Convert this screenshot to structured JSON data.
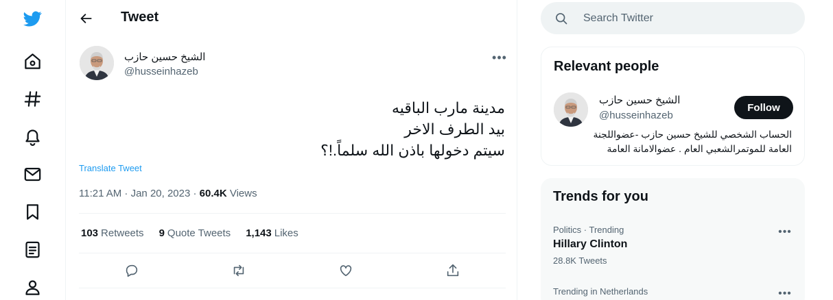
{
  "header": {
    "title": "Tweet"
  },
  "tweet": {
    "author_name": "الشيخ حسين حازب",
    "author_handle": "@husseinhazeb",
    "text_lines": [
      "مدينة مارب الباقيه",
      "بيد الطرف الاخر",
      "سيتم دخولها باذن الله سلماً.!؟"
    ],
    "translate_label": "Translate Tweet",
    "time": "11:21 AM · Jan 20, 2023 · ",
    "views_count": "60.4K",
    "views_label": " Views",
    "stats": [
      {
        "count": "103",
        "label": "Retweets"
      },
      {
        "count": "9",
        "label": "Quote Tweets"
      },
      {
        "count": "1,143",
        "label": "Likes"
      }
    ]
  },
  "search": {
    "placeholder": "Search Twitter"
  },
  "relevant_people": {
    "title": "Relevant people",
    "name": "الشيخ حسين حازب",
    "handle": "@husseinhazeb",
    "follow_label": "Follow",
    "bio_lines": [
      "الحساب الشخصي للشيخ حسين حازب -عضواللجنة",
      "العامة للموتمرالشعبي العام . عضوالامانة العامة"
    ]
  },
  "trends": {
    "title": "Trends for you",
    "items": [
      {
        "category": "Politics · Trending",
        "name": "Hillary Clinton",
        "count": "28.8K Tweets"
      },
      {
        "category": "Trending in Netherlands",
        "name": "",
        "count": ""
      }
    ]
  },
  "colors": {
    "accent": "#1d9bf0",
    "text": "#0f1419",
    "muted": "#536471"
  },
  "icons": {
    "nav": [
      "twitter-logo-icon",
      "home-icon",
      "explore-hashtag-icon",
      "notifications-bell-icon",
      "messages-envelope-icon",
      "bookmarks-icon",
      "lists-icon",
      "profile-icon"
    ],
    "actions": [
      "reply-icon",
      "retweet-icon",
      "like-heart-icon",
      "share-icon"
    ]
  }
}
